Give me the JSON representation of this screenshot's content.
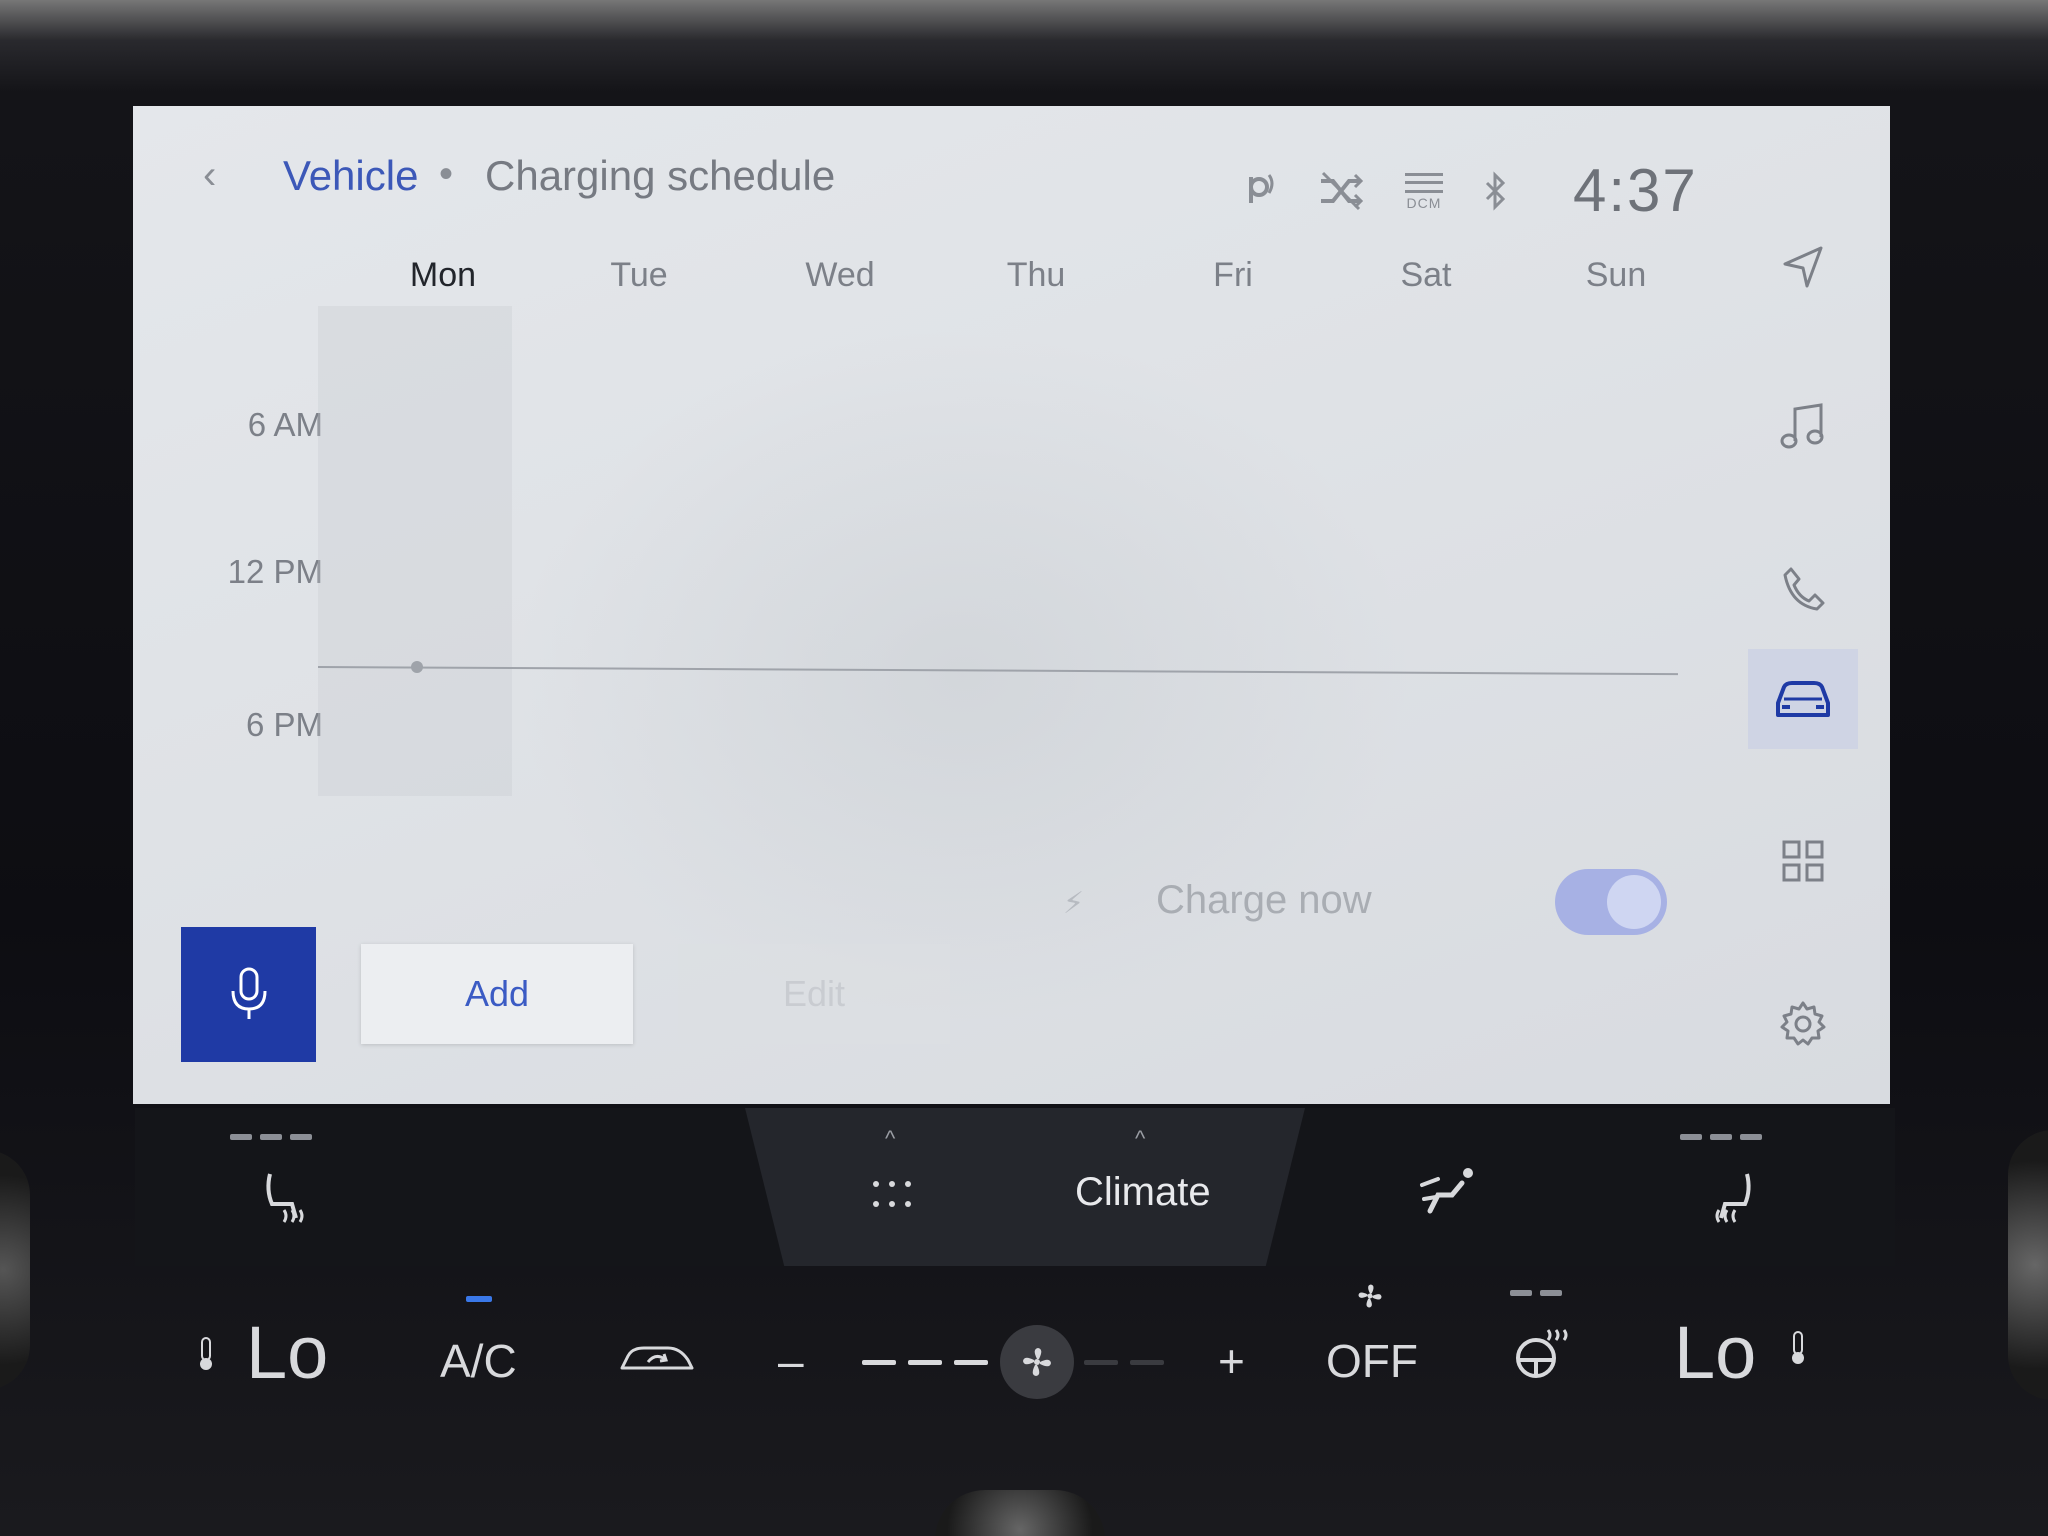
{
  "header": {
    "back_label": "‹",
    "breadcrumb_parent": "Vehicle",
    "separator": "•",
    "title": "Charging schedule"
  },
  "status": {
    "icons": [
      "wireless-charging-icon",
      "shuffle-off-icon",
      "dcm-signal-icon",
      "bluetooth-icon"
    ],
    "dcm_label": "DCM",
    "time": "4:37"
  },
  "schedule": {
    "days": [
      "Mon",
      "Tue",
      "Wed",
      "Thu",
      "Fri",
      "Sat",
      "Sun"
    ],
    "selected_day": "Mon",
    "time_labels": [
      "6 AM",
      "12 PM",
      "6 PM"
    ]
  },
  "charge_now": {
    "label": "Charge now",
    "enabled": true
  },
  "actions": {
    "add_label": "Add",
    "edit_label": "Edit"
  },
  "rail": [
    "navigation-icon",
    "music-icon",
    "phone-icon",
    "vehicle-icon",
    "apps-icon",
    "settings-icon"
  ],
  "climate_bar": {
    "label": "Climate"
  },
  "hard_keys": {
    "left_temp": "Lo",
    "ac_label": "A/C",
    "minus": "–",
    "plus": "+",
    "fan_off": "OFF",
    "right_temp": "Lo"
  },
  "colors": {
    "accent": "#1f3aa5",
    "link": "#3c58b8",
    "toggle_on": "#a7b1e4",
    "ac_indicator": "#3a78e8"
  }
}
